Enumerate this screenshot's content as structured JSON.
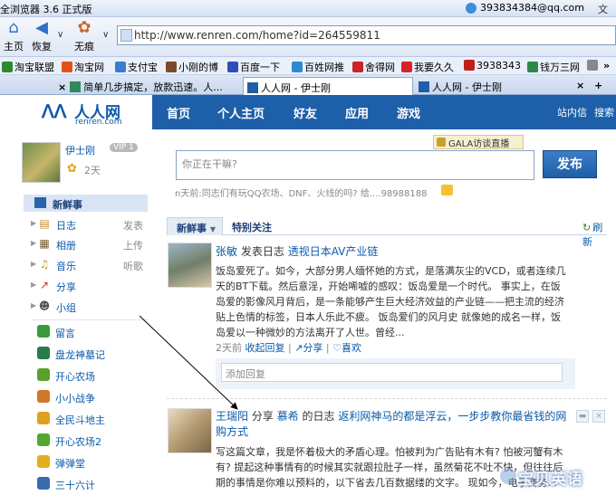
{
  "browser": {
    "title": "全浏览器 3.6 正式版",
    "account": "393834384@qq.com",
    "file_menu": "文件",
    "nav": {
      "home": "主页",
      "restore": "恢复",
      "no_cache": "无痕"
    },
    "url": "http://www.renren.com/home?id=264559811",
    "favorites": [
      "淘宝联盟",
      "淘宝网",
      "支付宝",
      "小刚的博",
      "百度一下",
      "百姓网推",
      "舍得网",
      "我要久久",
      "3938343",
      "钱万三网"
    ],
    "tabs": [
      {
        "label": "简单几步搞定，放款迅速。人..."
      },
      {
        "label": "人人网 - 伊士刚"
      },
      {
        "label": "人人网 - 伊士刚"
      }
    ],
    "colors": {
      "chrome": "#dfe8f5",
      "accent": "#1d5fa8"
    }
  },
  "renren": {
    "logo_name": "人人网",
    "logo_domain": "renren.com",
    "nav": [
      "首页",
      "个人主页",
      "好友",
      "应用",
      "游戏"
    ],
    "nav_right": [
      "站内信",
      "搜索"
    ]
  },
  "profile": {
    "name": "伊士刚",
    "vip": "VIP 1",
    "days": "2天"
  },
  "left_menu": {
    "fresh": "新鲜事",
    "items": [
      {
        "label": "日志",
        "action": "发表",
        "icon": "journal-icon"
      },
      {
        "label": "相册",
        "action": "上传",
        "icon": "album-icon"
      },
      {
        "label": "音乐",
        "action": "听歌",
        "icon": "music-icon"
      },
      {
        "label": "分享",
        "action": "",
        "icon": "share-icon"
      },
      {
        "label": "小组",
        "action": "",
        "icon": "group-icon"
      }
    ],
    "apps": [
      {
        "label": "留言",
        "color": "#3a9a3a"
      },
      {
        "label": "盘龙神墓记",
        "color": "#2a7a4a"
      },
      {
        "label": "开心农场",
        "color": "#5aa02c"
      },
      {
        "label": "小小战争",
        "color": "#d2762a"
      },
      {
        "label": "全民斗地主",
        "color": "#e0a020"
      },
      {
        "label": "开心农场2",
        "color": "#4ea832"
      },
      {
        "label": "弹弹堂",
        "color": "#e0b020"
      },
      {
        "label": "三十六计",
        "color": "#3a6ab0"
      }
    ]
  },
  "composer": {
    "gala": "GALA访谈直播",
    "placeholder": "你正在干嘛?",
    "publish": "发布",
    "hint": "n天前:同志们有玩QQ农场、DNF、火线的吗? 给....98988188"
  },
  "feed": {
    "tab_fresh": "新鲜事",
    "tab_focus": "特别关注",
    "refresh": "刷新",
    "post1": {
      "user": "张敏",
      "action": "发表日志",
      "title": "透视日本AV产业链",
      "body": "饭岛爱死了。如今，大部分男人缅怀她的方式，是落满灰尘的VCD，或者连续几天的BT下载。然后意淫，开始唏嘘的感叹：饭岛爱是一个时代。 事实上，在饭岛爱的影像风月背后，是一条能够产生巨大经济效益的产业链——把主流的经济贴上色情的标签，日本人乐此不疲。 饭岛爱们的风月史 就像她的成名一样，饭岛爱以一种微妙的方法离开了人世。曾经...",
      "time": "2天前",
      "collapse": "收起回复",
      "share": "分享",
      "like": "喜欢",
      "reply_placeholder": "添加回复"
    },
    "post2": {
      "user": "王瑞阳",
      "action": "分享",
      "owner": "慕希",
      "owner_suffix": "的日志",
      "title": "返利网神马的都是浮云，一步步教你最省钱的网购方式",
      "body": "写这篇文章，我是怀着极大的矛盾心理。怕被判为广告贴有木有? 怕被河蟹有木有? 提起这种事情有的时候其实就跟拉肚子一样，虽然菊花不吐不快，但往往后期的事情是你难以预料的，以下省去几百数据缕的文字。 现如今，电子商务..."
    },
    "watermark": "宝贝英语"
  }
}
